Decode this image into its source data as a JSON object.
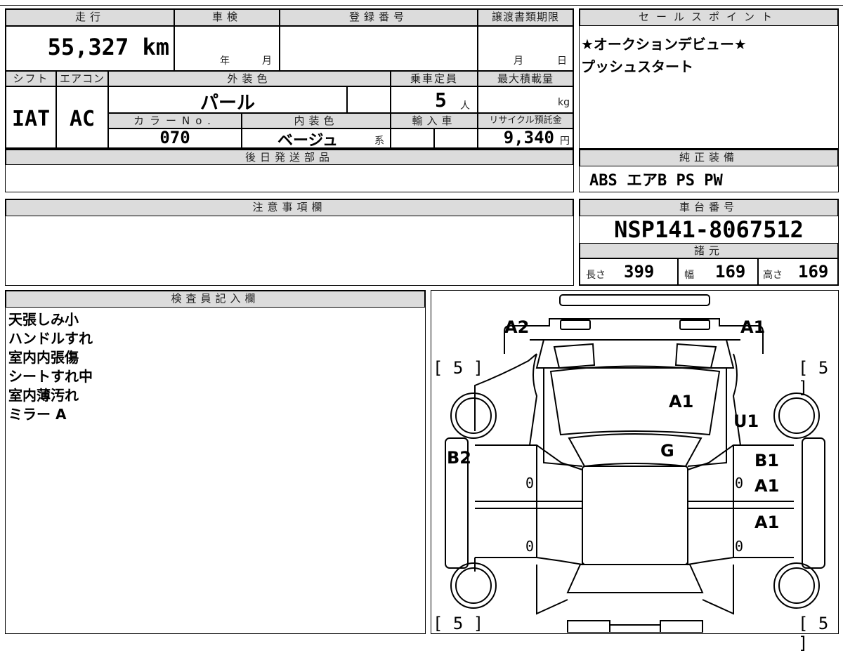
{
  "row1": {
    "mileage_label": "走行",
    "mileage_value": "55,327 km",
    "inspection_label": "車検",
    "inspection_year": "年",
    "inspection_month": "月",
    "registration_label": "登録番号",
    "transfer_label": "譲渡書類期限",
    "transfer_month": "月",
    "transfer_day": "日"
  },
  "row2": {
    "shift_label": "シフト",
    "shift_value": "IAT",
    "ac_label": "エアコン",
    "ac_value": "AC",
    "exterior_label": "外装色",
    "exterior_value": "パール",
    "capacity_label": "乗車定員",
    "capacity_value": "5",
    "capacity_unit": "人",
    "load_label": "最大積載量",
    "load_unit": "kg",
    "color_no_label": "カラーNo.",
    "color_no_value": "070",
    "interior_label": "内装色",
    "interior_value": "ベージュ",
    "interior_suffix": "系",
    "import_label": "輸入車",
    "recycle_label": "リサイクル預託金",
    "recycle_value": "9,340",
    "recycle_unit": "円"
  },
  "deferred": {
    "label": "後日発送部品"
  },
  "sales_point": {
    "label": "セールスポイント",
    "lines": [
      "★オークションデビュー★",
      "プッシュスタート"
    ]
  },
  "genuine_equipment": {
    "label": "純正装備",
    "value": "ABS エアB PS PW"
  },
  "caution": {
    "label": "注意事項欄"
  },
  "chassis": {
    "label": "車台番号",
    "value": "NSP141-8067512"
  },
  "specs": {
    "label": "諸元",
    "length_label": "長さ",
    "length_value": "399",
    "width_label": "幅",
    "width_value": "169",
    "height_label": "高さ",
    "height_value": "169"
  },
  "inspector": {
    "label": "検査員記入欄",
    "notes": [
      "天張しみ小",
      "ハンドルすれ",
      "室内内張傷",
      "シートすれ中",
      "室内薄汚れ",
      "ミラー A"
    ]
  },
  "diagram": {
    "marks": {
      "front_left": "A2",
      "front_right": "A1",
      "hood": "A1",
      "front_right_fender": "U1",
      "windshield": "G",
      "left_front_door": "B2",
      "right_front_door": "B1",
      "right_front_door_2": "A1",
      "right_rear_door": "A1"
    },
    "tires": [
      "[ 5 ]",
      "[ 5 ]",
      "[ 5 ]",
      "[ 5 ]"
    ],
    "door_zeros": [
      "0",
      "0",
      "0",
      "0"
    ]
  }
}
